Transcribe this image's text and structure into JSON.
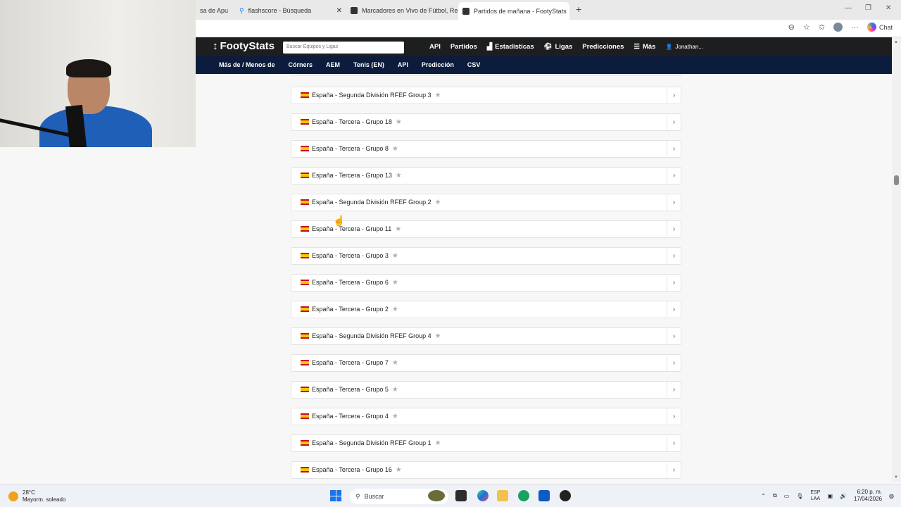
{
  "browser": {
    "tabs": [
      {
        "title": "sa de Apu",
        "active": false
      },
      {
        "title": "flashscore - Búsqueda",
        "active": false
      },
      {
        "title": "Marcadores en Vivo de Fútbol, Re",
        "active": false
      },
      {
        "title": "Partidos de mañana - FootyStats",
        "active": true
      }
    ],
    "chat_label": "Chat"
  },
  "site": {
    "logo_text": "FootyStats",
    "search_placeholder": "Buscar Equipos y Ligas",
    "nav": [
      "API",
      "Partidos",
      "Estadísticas",
      "Ligas",
      "Predicciones",
      "Más"
    ],
    "user": "Jonathan...",
    "subnav": [
      "Más de / Menos de",
      "Córners",
      "AEM",
      "Tenis (EN)",
      "API",
      "Predicción",
      "CSV"
    ]
  },
  "leagues": [
    "España - Segunda División RFEF Group 3",
    "España - Tercera - Grupo 18",
    "España - Tercera - Grupo 8",
    "España - Tercera - Grupo 13",
    "España - Segunda División RFEF Group 2",
    "España - Tercera - Grupo 11",
    "España - Tercera - Grupo 3",
    "España - Tercera - Grupo 6",
    "España - Tercera - Grupo 2",
    "España - Segunda División RFEF Group 4",
    "España - Tercera - Grupo 7",
    "España - Tercera - Grupo 5",
    "España - Tercera - Grupo 4",
    "España - Segunda División RFEF Group 1",
    "España - Tercera - Grupo 16"
  ],
  "taskbar": {
    "temperature": "28°C",
    "weather": "Mayorm. soleado",
    "search": "Buscar",
    "lang_top": "ESP",
    "lang_bottom": "LAA",
    "time": "6:20 p. m.",
    "date": "17/04/2026"
  }
}
